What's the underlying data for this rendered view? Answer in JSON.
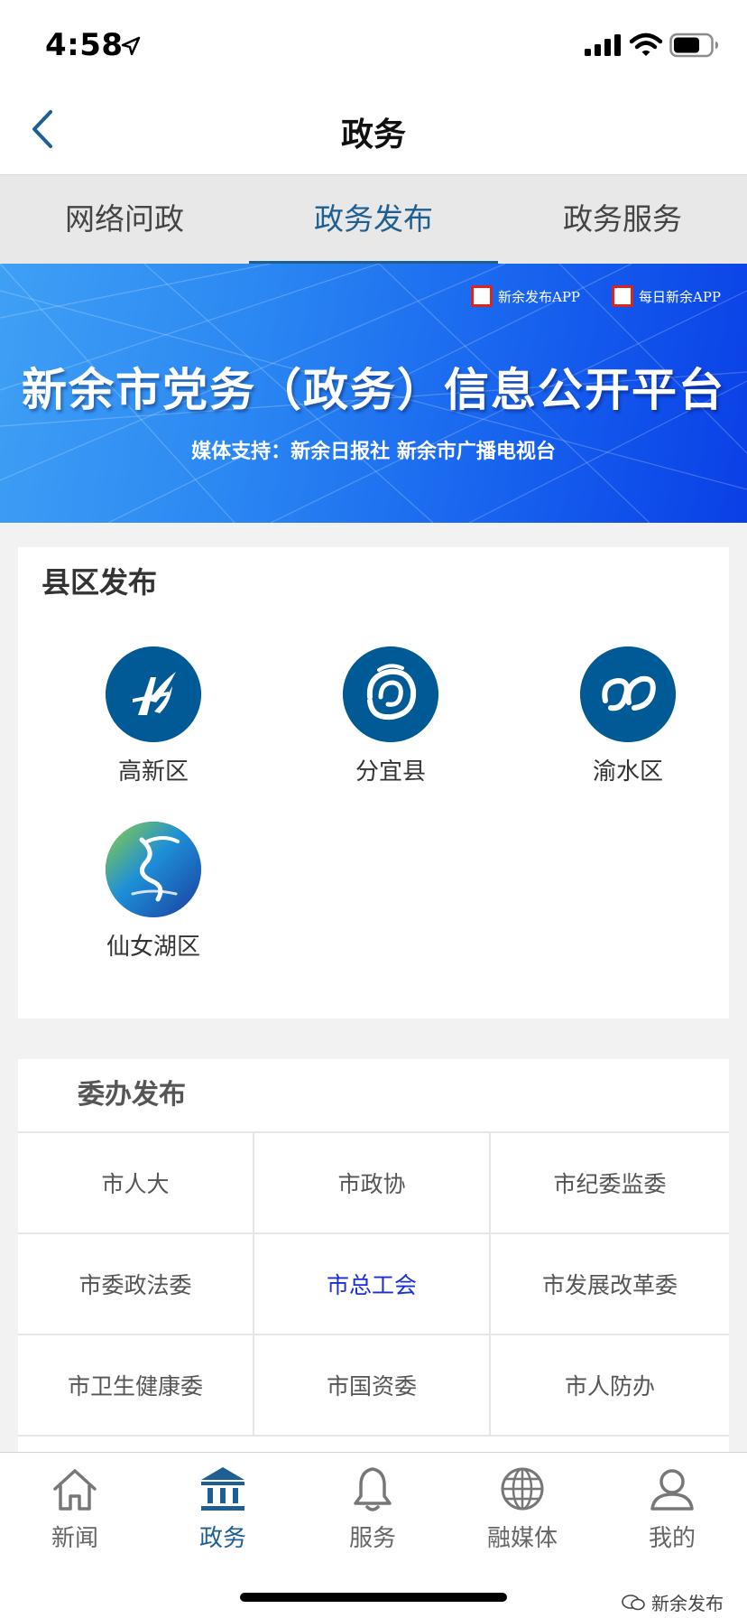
{
  "status_bar": {
    "time": "4:58"
  },
  "nav": {
    "title": "政务"
  },
  "tabs": [
    {
      "label": "网络问政",
      "active": false
    },
    {
      "label": "政务发布",
      "active": true
    },
    {
      "label": "政务服务",
      "active": false
    }
  ],
  "banner": {
    "app1": "新余发布APP",
    "app2": "每日新余APP",
    "title": "新余市党务（政务）信息公开平台",
    "subtitle": "媒体支持：新余日报社  新余市广播电视台"
  },
  "county_section": {
    "title": "县区发布",
    "items": [
      {
        "name": "高新区",
        "icon": "gaoxin-logo-icon"
      },
      {
        "name": "分宜县",
        "icon": "fenyi-logo-icon"
      },
      {
        "name": "渝水区",
        "icon": "yushui-logo-icon"
      },
      {
        "name": "仙女湖区",
        "icon": "xiannvhu-logo-icon"
      }
    ]
  },
  "dept_section": {
    "title": "委办发布",
    "items": [
      {
        "label": "市人大"
      },
      {
        "label": "市政协"
      },
      {
        "label": "市纪委监委"
      },
      {
        "label": "市委政法委"
      },
      {
        "label": "市总工会",
        "highlighted": true
      },
      {
        "label": "市发展改革委"
      },
      {
        "label": "市卫生健康委"
      },
      {
        "label": "市国资委"
      },
      {
        "label": "市人防办"
      }
    ]
  },
  "bottom_tabs": [
    {
      "label": "新闻",
      "icon": "home-icon"
    },
    {
      "label": "政务",
      "icon": "government-building-icon",
      "active": true
    },
    {
      "label": "服务",
      "icon": "bell-icon"
    },
    {
      "label": "融媒体",
      "icon": "globe-icon"
    },
    {
      "label": "我的",
      "icon": "user-icon"
    }
  ],
  "watermark": "新余发布",
  "colors": {
    "accent": "#1d5e93",
    "link_highlight": "#1a2fd6",
    "logo_blue": "#005a95"
  }
}
